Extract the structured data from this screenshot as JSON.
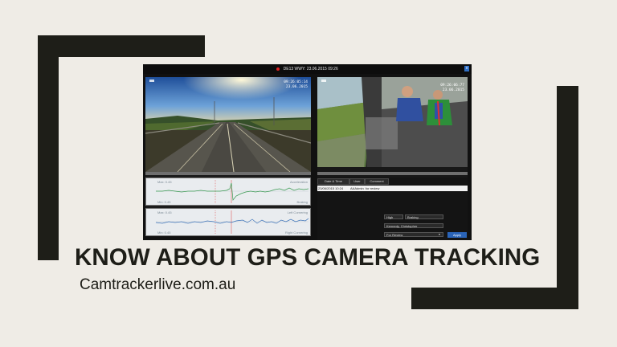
{
  "slide": {
    "headline": "KNOW ABOUT GPS CAMERA TRACKING",
    "subtitle": "Camtrackerlive.com.au"
  },
  "player": {
    "title": "DE13 WWY: 23.06.2015 09:26",
    "close_label": "x",
    "camera1": {
      "timestamp_time": "09:26:05:14",
      "timestamp_date": "23.06.2015"
    },
    "camera2": {
      "timestamp_time": "09:26:06:77",
      "timestamp_date": "23.06.2015"
    },
    "chart1": {
      "max_label": "Max: 0.45",
      "min_label": "Min: 0.45",
      "top_label": "Acceleration",
      "bottom_label": "Braking"
    },
    "chart2": {
      "max_label": "Max: 0.45",
      "min_label": "Min: 0.45",
      "top_label": "Left Cornering",
      "bottom_label": "Right Cornering"
    },
    "grid": {
      "columns": [
        "Date & Time",
        "User",
        "Comment"
      ],
      "rows": [
        [
          "23/06/2015 10:24",
          "AAAdmin",
          "for review"
        ]
      ]
    },
    "fields": {
      "severity": "High",
      "event": "Braking",
      "driver": "Kennedy, Christopher",
      "status": "For Review",
      "apply_label": "Apply"
    }
  },
  "colors": {
    "frame": "#1e1e18",
    "background": "#efece6",
    "accent_blue": "#2a64b8",
    "rec_red": "#dd2222"
  }
}
